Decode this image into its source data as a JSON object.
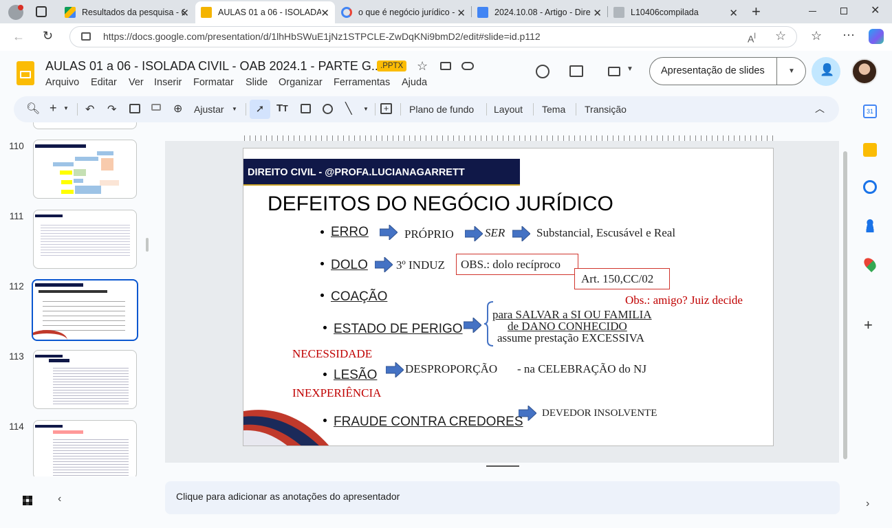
{
  "browser": {
    "tabs": [
      {
        "title": "Resultados da pesquisa - G",
        "icon": "google-drive-icon",
        "active": false
      },
      {
        "title": "AULAS 01 a 06 - ISOLADA",
        "icon": "google-slides-icon",
        "active": true
      },
      {
        "title": "o que é negócio jurídico -",
        "icon": "google-icon",
        "active": false
      },
      {
        "title": "2024.10.08 - Artigo - Dire",
        "icon": "google-docs-icon",
        "active": false
      },
      {
        "title": "L10406compilada",
        "icon": "page-icon",
        "active": false
      }
    ],
    "url": "https://docs.google.com/presentation/d/1lhHbSWuE1jNz1STPCLE-ZwDqKNi9bmD2/edit#slide=id.p112"
  },
  "app": {
    "doc_title": "AULAS 01 a 06 - ISOLADA CIVIL - OAB 2024.1 - PARTE G...",
    "badge": ".PPTX",
    "menus": [
      "Arquivo",
      "Editar",
      "Ver",
      "Inserir",
      "Formatar",
      "Slide",
      "Organizar",
      "Ferramentas",
      "Ajuda"
    ],
    "present_button": "Apresentação de slides"
  },
  "toolbar": {
    "zoom_label": "Ajustar",
    "background": "Plano de fundo",
    "layout": "Layout",
    "theme": "Tema",
    "transition": "Transição"
  },
  "filmstrip": {
    "numbers": [
      "110",
      "111",
      "112",
      "113",
      "114"
    ],
    "selected": "112"
  },
  "slide": {
    "banner": "DIREITO CIVIL - @PROFA.LUCIANAGARRETT",
    "title": "DEFEITOS DO NEGÓCIO JURÍDICO",
    "erro": "ERRO",
    "proprio": "PRÓPRIO",
    "ser": "SER",
    "erro_result": "Substancial, Escusável e Real",
    "dolo": "DOLO",
    "terceiro": "3º INDUZ",
    "obs_dolo": "OBS.: dolo recíproco",
    "art": "Art. 150,CC/02",
    "coacao": "COAÇÃO",
    "obs_amigo": "Obs.: amigo? Juiz decide",
    "estado": "ESTADO DE PERIGO",
    "perigo_1": "para SALVAR a SI OU FAMILIA",
    "perigo_2": "de DANO CONHECIDO",
    "perigo_3": "assume prestação EXCESSIVA",
    "necessidade": "NECESSIDADE",
    "lesao": "LESÃO",
    "desproporcao": "DESPROPORÇÃO",
    "celebracao": "- na CELEBRAÇÃO do NJ",
    "inexperiencia": "INEXPERIÊNCIA",
    "fraude": "FRAUDE CONTRA CREDORES",
    "devedor": "DEVEDOR INSOLVENTE"
  },
  "notes": "Clique para adicionar as anotações do apresentador",
  "colors": {
    "accent": "#0b57d0",
    "banner": "#101848",
    "arrow": "#4472c4",
    "red": "#c00000"
  }
}
